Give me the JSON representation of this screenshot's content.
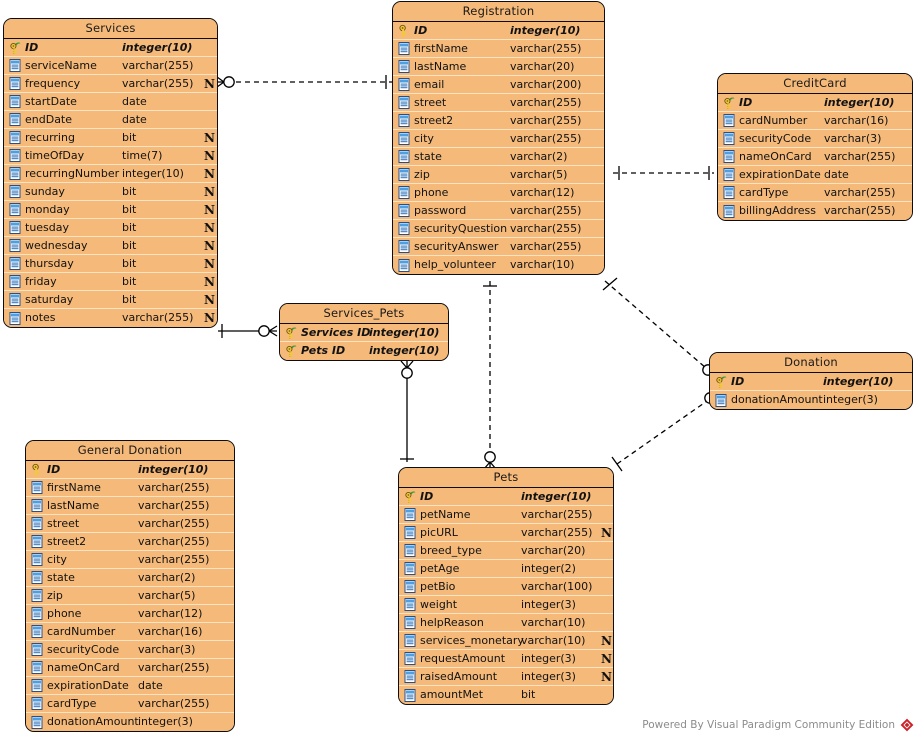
{
  "diagram": {
    "type": "entity-relationship-diagram",
    "tool": "Visual Paradigm Community Edition",
    "watermark": "Powered By Visual Paradigm Community Edition",
    "colors": {
      "entity_fill": "#f5b97a",
      "entity_border": "#0d0d0d",
      "row_divider": "#fbe3c4",
      "link": "#000000",
      "watermark_text": "#8c8c8c",
      "logo_red": "#cc2229"
    }
  },
  "entities": {
    "services": {
      "name": "Services",
      "columns": [
        {
          "name": "ID",
          "type": "integer(10)",
          "icon": "primary-key-icon",
          "pk": true,
          "nullable": false
        },
        {
          "name": "serviceName",
          "type": "varchar(255)",
          "icon": "column-icon",
          "pk": false,
          "nullable": false
        },
        {
          "name": "frequency",
          "type": "varchar(255)",
          "icon": "column-icon",
          "pk": false,
          "nullable": true
        },
        {
          "name": "startDate",
          "type": "date",
          "icon": "column-icon",
          "pk": false,
          "nullable": false
        },
        {
          "name": "endDate",
          "type": "date",
          "icon": "column-icon",
          "pk": false,
          "nullable": false
        },
        {
          "name": "recurring",
          "type": "bit",
          "icon": "column-icon",
          "pk": false,
          "nullable": true
        },
        {
          "name": "timeOfDay",
          "type": "time(7)",
          "icon": "column-icon",
          "pk": false,
          "nullable": true
        },
        {
          "name": "recurringNumber",
          "type": "integer(10)",
          "icon": "column-icon",
          "pk": false,
          "nullable": true
        },
        {
          "name": "sunday",
          "type": "bit",
          "icon": "column-icon",
          "pk": false,
          "nullable": true
        },
        {
          "name": "monday",
          "type": "bit",
          "icon": "column-icon",
          "pk": false,
          "nullable": true
        },
        {
          "name": "tuesday",
          "type": "bit",
          "icon": "column-icon",
          "pk": false,
          "nullable": true
        },
        {
          "name": "wednesday",
          "type": "bit",
          "icon": "column-icon",
          "pk": false,
          "nullable": true
        },
        {
          "name": "thursday",
          "type": "bit",
          "icon": "column-icon",
          "pk": false,
          "nullable": true
        },
        {
          "name": "friday",
          "type": "bit",
          "icon": "column-icon",
          "pk": false,
          "nullable": true
        },
        {
          "name": "saturday",
          "type": "bit",
          "icon": "column-icon",
          "pk": false,
          "nullable": true
        },
        {
          "name": "notes",
          "type": "varchar(255)",
          "icon": "column-icon",
          "pk": false,
          "nullable": true
        }
      ]
    },
    "registration": {
      "name": "Registration",
      "columns": [
        {
          "name": "ID",
          "type": "integer(10)",
          "icon": "primary-key-icon",
          "pk": true,
          "nullable": false
        },
        {
          "name": "firstName",
          "type": "varchar(255)",
          "icon": "column-icon",
          "pk": false,
          "nullable": false
        },
        {
          "name": "lastName",
          "type": "varchar(20)",
          "icon": "column-icon",
          "pk": false,
          "nullable": false
        },
        {
          "name": "email",
          "type": "varchar(200)",
          "icon": "column-icon",
          "pk": false,
          "nullable": false
        },
        {
          "name": "street",
          "type": "varchar(255)",
          "icon": "column-icon",
          "pk": false,
          "nullable": false
        },
        {
          "name": "street2",
          "type": "varchar(255)",
          "icon": "column-icon",
          "pk": false,
          "nullable": false
        },
        {
          "name": "city",
          "type": "varchar(255)",
          "icon": "column-icon",
          "pk": false,
          "nullable": false
        },
        {
          "name": "state",
          "type": "varchar(2)",
          "icon": "column-icon",
          "pk": false,
          "nullable": false
        },
        {
          "name": "zip",
          "type": "varchar(5)",
          "icon": "column-icon",
          "pk": false,
          "nullable": false
        },
        {
          "name": "phone",
          "type": "varchar(12)",
          "icon": "column-icon",
          "pk": false,
          "nullable": false
        },
        {
          "name": "password",
          "type": "varchar(255)",
          "icon": "column-icon",
          "pk": false,
          "nullable": false
        },
        {
          "name": "securityQuestion",
          "type": "varchar(255)",
          "icon": "column-icon",
          "pk": false,
          "nullable": false
        },
        {
          "name": "securityAnswer",
          "type": "varchar(255)",
          "icon": "column-icon",
          "pk": false,
          "nullable": false
        },
        {
          "name": "help_volunteer",
          "type": "varchar(10)",
          "icon": "column-icon",
          "pk": false,
          "nullable": false
        }
      ]
    },
    "creditcard": {
      "name": "CreditCard",
      "columns": [
        {
          "name": "ID",
          "type": "integer(10)",
          "icon": "primary-key-icon",
          "pk": true,
          "nullable": false
        },
        {
          "name": "cardNumber",
          "type": "varchar(16)",
          "icon": "column-icon",
          "pk": false,
          "nullable": false
        },
        {
          "name": "securityCode",
          "type": "varchar(3)",
          "icon": "column-icon",
          "pk": false,
          "nullable": false
        },
        {
          "name": "nameOnCard",
          "type": "varchar(255)",
          "icon": "column-icon",
          "pk": false,
          "nullable": false
        },
        {
          "name": "expirationDate",
          "type": "date",
          "icon": "column-icon",
          "pk": false,
          "nullable": false
        },
        {
          "name": "cardType",
          "type": "varchar(255)",
          "icon": "column-icon",
          "pk": false,
          "nullable": false
        },
        {
          "name": "billingAddress",
          "type": "varchar(255)",
          "icon": "column-icon",
          "pk": false,
          "nullable": false
        }
      ]
    },
    "services_pets": {
      "name": "Services_Pets",
      "columns": [
        {
          "name": "Services ID",
          "type": "integer(10)",
          "icon": "primary-key-icon",
          "pk": true,
          "nullable": false
        },
        {
          "name": "Pets ID",
          "type": "integer(10)",
          "icon": "primary-key-icon",
          "pk": true,
          "nullable": false
        }
      ]
    },
    "donation": {
      "name": "Donation",
      "columns": [
        {
          "name": "ID",
          "type": "integer(10)",
          "icon": "primary-key-icon",
          "pk": true,
          "nullable": false
        },
        {
          "name": "donationAmount",
          "type": "integer(3)",
          "icon": "column-icon",
          "pk": false,
          "nullable": false
        }
      ]
    },
    "general_donation": {
      "name": "General Donation",
      "columns": [
        {
          "name": "ID",
          "type": "integer(10)",
          "icon": "primary-key-icon",
          "pk": true,
          "nullable": false
        },
        {
          "name": "firstName",
          "type": "varchar(255)",
          "icon": "column-icon",
          "pk": false,
          "nullable": false
        },
        {
          "name": "lastName",
          "type": "varchar(255)",
          "icon": "column-icon",
          "pk": false,
          "nullable": false
        },
        {
          "name": "street",
          "type": "varchar(255)",
          "icon": "column-icon",
          "pk": false,
          "nullable": false
        },
        {
          "name": "street2",
          "type": "varchar(255)",
          "icon": "column-icon",
          "pk": false,
          "nullable": false
        },
        {
          "name": "city",
          "type": "varchar(255)",
          "icon": "column-icon",
          "pk": false,
          "nullable": false
        },
        {
          "name": "state",
          "type": "varchar(2)",
          "icon": "column-icon",
          "pk": false,
          "nullable": false
        },
        {
          "name": "zip",
          "type": "varchar(5)",
          "icon": "column-icon",
          "pk": false,
          "nullable": false
        },
        {
          "name": "phone",
          "type": "varchar(12)",
          "icon": "column-icon",
          "pk": false,
          "nullable": false
        },
        {
          "name": "cardNumber",
          "type": "varchar(16)",
          "icon": "column-icon",
          "pk": false,
          "nullable": false
        },
        {
          "name": "securityCode",
          "type": "varchar(3)",
          "icon": "column-icon",
          "pk": false,
          "nullable": false
        },
        {
          "name": "nameOnCard",
          "type": "varchar(255)",
          "icon": "column-icon",
          "pk": false,
          "nullable": false
        },
        {
          "name": "expirationDate",
          "type": "date",
          "icon": "column-icon",
          "pk": false,
          "nullable": false
        },
        {
          "name": "cardType",
          "type": "varchar(255)",
          "icon": "column-icon",
          "pk": false,
          "nullable": false
        },
        {
          "name": "donationAmount",
          "type": "integer(3)",
          "icon": "column-icon",
          "pk": false,
          "nullable": false
        }
      ]
    },
    "pets": {
      "name": "Pets",
      "columns": [
        {
          "name": "ID",
          "type": "integer(10)",
          "icon": "primary-key-icon",
          "pk": true,
          "nullable": false
        },
        {
          "name": "petName",
          "type": "varchar(255)",
          "icon": "column-icon",
          "pk": false,
          "nullable": false
        },
        {
          "name": "picURL",
          "type": "varchar(255)",
          "icon": "column-icon",
          "pk": false,
          "nullable": true
        },
        {
          "name": "breed_type",
          "type": "varchar(20)",
          "icon": "column-icon",
          "pk": false,
          "nullable": false
        },
        {
          "name": "petAge",
          "type": "integer(2)",
          "icon": "column-icon",
          "pk": false,
          "nullable": false
        },
        {
          "name": "petBio",
          "type": "varchar(100)",
          "icon": "column-icon",
          "pk": false,
          "nullable": false
        },
        {
          "name": "weight",
          "type": "integer(3)",
          "icon": "column-icon",
          "pk": false,
          "nullable": false
        },
        {
          "name": "helpReason",
          "type": "varchar(10)",
          "icon": "column-icon",
          "pk": false,
          "nullable": false
        },
        {
          "name": "services_monetary",
          "type": "varchar(10)",
          "icon": "column-icon",
          "pk": false,
          "nullable": true
        },
        {
          "name": "requestAmount",
          "type": "integer(3)",
          "icon": "column-icon",
          "pk": false,
          "nullable": true
        },
        {
          "name": "raisedAmount",
          "type": "integer(3)",
          "icon": "column-icon",
          "pk": false,
          "nullable": true
        },
        {
          "name": "amountMet",
          "type": "bit",
          "icon": "column-icon",
          "pk": false,
          "nullable": false
        }
      ]
    }
  },
  "relationships": [
    {
      "from": "Services",
      "to": "Registration",
      "style": "dashed",
      "from_end": "crows-foot-optional",
      "to_end": "one-mandatory"
    },
    {
      "from": "Registration",
      "to": "CreditCard",
      "style": "dashed",
      "from_end": "one-mandatory",
      "to_end": "one-mandatory"
    },
    {
      "from": "Registration",
      "to": "Donation",
      "style": "dashed",
      "from_end": "one-mandatory",
      "to_end": "crows-foot-optional"
    },
    {
      "from": "Registration",
      "to": "Pets",
      "style": "dashed",
      "from_end": "one-mandatory",
      "to_end": "crows-foot-optional"
    },
    {
      "from": "Pets",
      "to": "Donation",
      "style": "dashed",
      "from_end": "one-mandatory",
      "to_end": "crows-foot-optional"
    },
    {
      "from": "Services",
      "to": "Services_Pets",
      "style": "solid",
      "from_end": "one-mandatory",
      "to_end": "crows-foot-optional"
    },
    {
      "from": "Services_Pets",
      "to": "Pets",
      "style": "solid",
      "from_end": "crows-foot-optional",
      "to_end": "one-mandatory"
    }
  ],
  "nullable_marker": "N"
}
